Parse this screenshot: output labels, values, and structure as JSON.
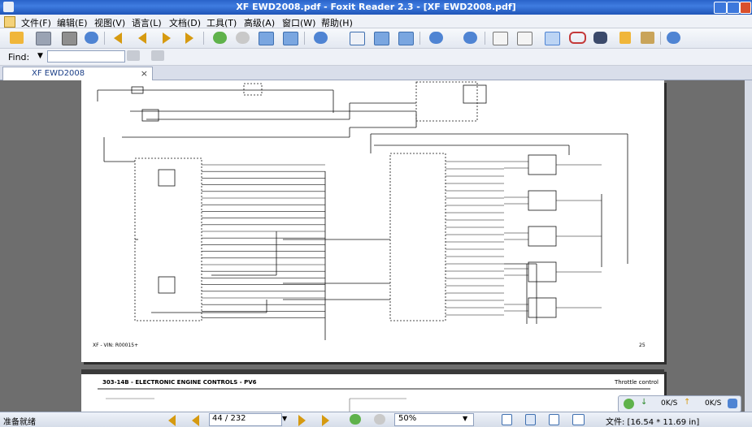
{
  "window": {
    "title": "XF EWD2008.pdf - Foxit Reader 2.3 - [XF EWD2008.pdf]"
  },
  "menu": [
    "文件(F)",
    "编辑(E)",
    "视图(V)",
    "语言(L)",
    "文档(D)",
    "工具(T)",
    "高级(A)",
    "窗口(W)",
    "帮助(H)"
  ],
  "toolbar_icons": [
    "open-icon",
    "save-icon",
    "print-icon",
    "email-icon",
    "first-page-icon",
    "previous-page-icon",
    "next-page-icon",
    "last-page-icon",
    "go-back-icon",
    "go-forward-icon",
    "rotate-left-icon",
    "rotate-right-icon",
    "zoom-in-icon",
    "actual-size-icon",
    "fit-page-icon",
    "fit-width-icon",
    "zoom-out-icon",
    "zoom-in-plus-icon",
    "bookmark-icon",
    "thumbnail-icon",
    "hand-tool-icon",
    "select-tool-icon",
    "find-icon",
    "text-tool-icon",
    "snapshot-icon",
    "help-icon"
  ],
  "findbar": {
    "label": "Find:",
    "value": ""
  },
  "tab": {
    "label": "XF EWD2008",
    "close": "×"
  },
  "document": {
    "page1_footer_left": "XF - VIN: R00015+",
    "page1_footer_right": "25",
    "page2_header_left": "303-14B - ELECTRONIC ENGINE CONTROLS - PV6",
    "page2_header_right": "Throttle control"
  },
  "network": {
    "download": "0K/S",
    "upload": "0K/S"
  },
  "statusbar": {
    "status": "准备就绪",
    "page": "44 / 232",
    "zoom": "50%",
    "file_size": "文件: [16.54 * 11.69 in]"
  }
}
